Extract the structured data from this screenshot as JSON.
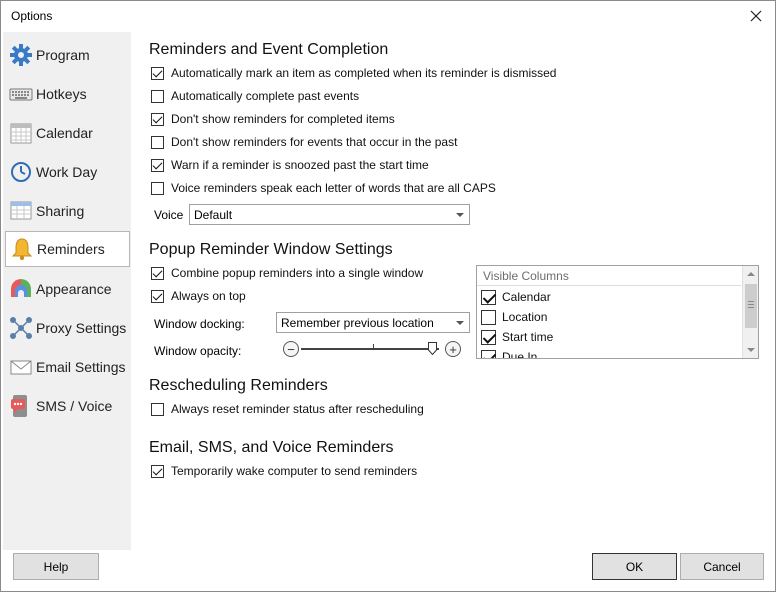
{
  "window": {
    "title": "Options"
  },
  "sidebar": {
    "items": [
      {
        "label": "Program",
        "icon": "gear-icon"
      },
      {
        "label": "Hotkeys",
        "icon": "keyboard-icon"
      },
      {
        "label": "Calendar",
        "icon": "calendar-icon"
      },
      {
        "label": "Work Day",
        "icon": "clock-icon"
      },
      {
        "label": "Sharing",
        "icon": "sharing-icon"
      },
      {
        "label": "Reminders",
        "icon": "bell-icon"
      },
      {
        "label": "Appearance",
        "icon": "palette-icon"
      },
      {
        "label": "Proxy Settings",
        "icon": "network-icon"
      },
      {
        "label": "Email Settings",
        "icon": "envelope-icon"
      },
      {
        "label": "SMS / Voice",
        "icon": "chat-icon"
      }
    ],
    "active": "Reminders"
  },
  "reminders": {
    "title": "Reminders and Event Completion",
    "options": [
      {
        "label": "Automatically mark an item as completed when its reminder is dismissed",
        "checked": true
      },
      {
        "label": "Automatically complete past events",
        "checked": false
      },
      {
        "label": "Don't show reminders for completed items",
        "checked": true
      },
      {
        "label": "Don't show reminders for events that occur in the past",
        "checked": false
      },
      {
        "label": "Warn if a reminder is snoozed past the start time",
        "checked": true
      },
      {
        "label": "Voice reminders speak each letter of words that are all CAPS",
        "checked": false
      }
    ],
    "voice_label": "Voice",
    "voice_value": "Default"
  },
  "popup": {
    "title": "Popup Reminder Window Settings",
    "options": [
      {
        "label": "Combine popup reminders into a single window",
        "checked": true
      },
      {
        "label": "Always on top",
        "checked": true
      }
    ],
    "docking_label": "Window docking:",
    "docking_value": "Remember previous location",
    "opacity_label": "Window opacity:",
    "opacity_level_percent": 95,
    "zoom_out": "−",
    "zoom_in": "+",
    "columns_header": "Visible Columns",
    "columns": [
      {
        "label": "Calendar",
        "checked": true
      },
      {
        "label": "Location",
        "checked": false
      },
      {
        "label": "Start time",
        "checked": true
      },
      {
        "label": "Due In",
        "checked": true
      }
    ]
  },
  "rescheduling": {
    "title": "Rescheduling Reminders",
    "options": [
      {
        "label": "Always reset reminder status after rescheduling",
        "checked": false
      }
    ]
  },
  "email": {
    "title": "Email, SMS, and Voice Reminders",
    "options": [
      {
        "label": "Temporarily wake computer to send reminders",
        "checked": true
      }
    ]
  },
  "buttons": {
    "help": "Help",
    "ok": "OK",
    "cancel": "Cancel"
  }
}
